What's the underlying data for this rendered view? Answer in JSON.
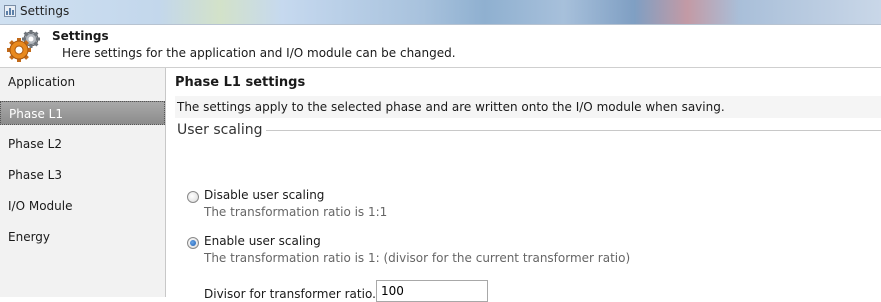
{
  "window": {
    "title": "Settings"
  },
  "header": {
    "title": "Settings",
    "description": "Here settings for the application and I/O module can be changed.",
    "icon": "gear-icon"
  },
  "sidebar": {
    "items": [
      {
        "label": "Application",
        "selected": false
      },
      {
        "label": "Phase L1",
        "selected": true
      },
      {
        "label": "Phase L2",
        "selected": false
      },
      {
        "label": "Phase L3",
        "selected": false
      },
      {
        "label": "I/O Module",
        "selected": false
      },
      {
        "label": "Energy",
        "selected": false
      }
    ]
  },
  "main": {
    "title": "Phase L1 settings",
    "description": "The settings apply to the selected phase and are written onto the I/O module when saving.",
    "group": {
      "legend": "User scaling",
      "options": [
        {
          "label": "Disable user scaling",
          "sub": "The transformation ratio is 1:1",
          "checked": false
        },
        {
          "label": "Enable user scaling",
          "sub": "The transformation ratio is 1: (divisor for the current transformer ratio)",
          "checked": true
        }
      ],
      "divisor_label": "Divisor for transformer ratio.",
      "divisor_value": "100"
    }
  }
}
